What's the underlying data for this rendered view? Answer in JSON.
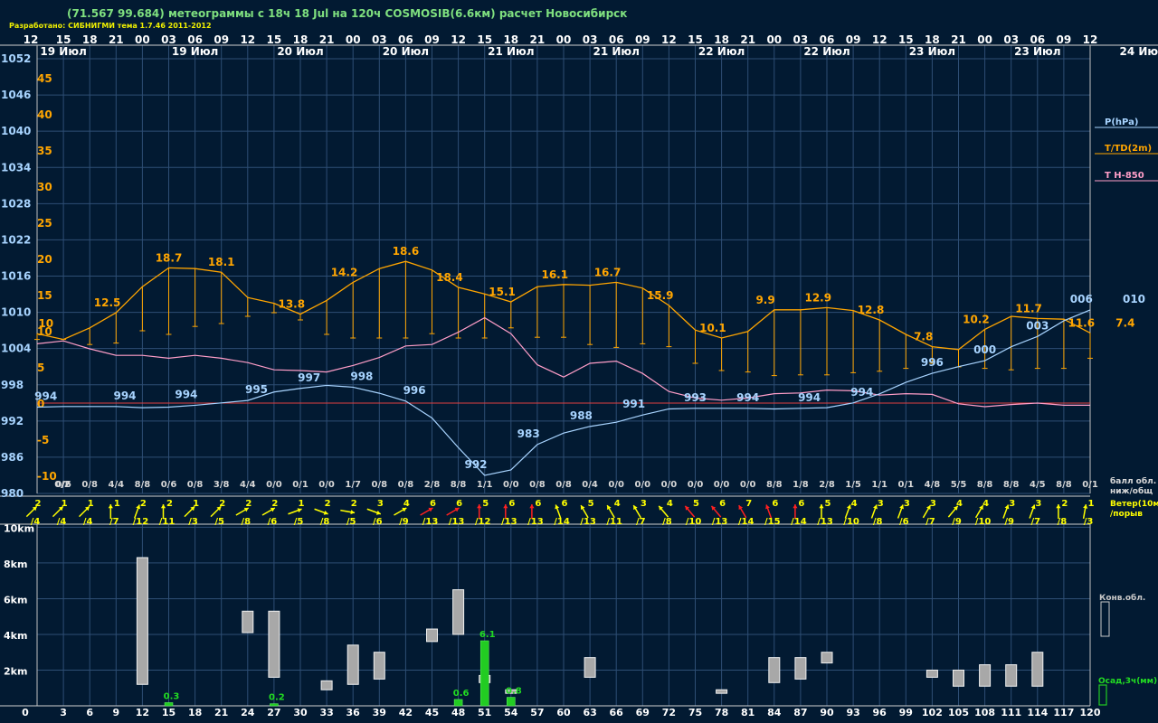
{
  "header": {
    "title": "(71.567 99.684) метеограммы с  18ч 18 Jul на 120ч COSMOSIB(6.6км) расчет Новосибирск",
    "credit": "Разработано: СИБНИГМИ тема 1.7.46 2011-2012"
  },
  "colors": {
    "background": "#021a32",
    "grid": "#2e4e74",
    "pressure": "#a8d4ff",
    "temperature": "#ffa500",
    "t850": "#ff9ec8",
    "zero_line": "#e04040",
    "cloud_bar": "#a8a8a8",
    "precip_bar": "#22cc22",
    "wind_yellow": "#ffff00",
    "wind_red": "#ff2020"
  },
  "chart_data": {
    "type": "meteogram",
    "x_hours": [
      0,
      3,
      6,
      9,
      12,
      15,
      18,
      21,
      24,
      27,
      30,
      33,
      36,
      39,
      42,
      45,
      48,
      51,
      54,
      57,
      60,
      63,
      66,
      69,
      72,
      75,
      78,
      81,
      84,
      87,
      90,
      93,
      96,
      99,
      102,
      105,
      108,
      111,
      114,
      117,
      120
    ],
    "time_labels": [
      "12",
      "15",
      "18",
      "21",
      "00",
      "03",
      "06",
      "09",
      "12",
      "15",
      "18",
      "21",
      "00",
      "03",
      "06",
      "09",
      "12",
      "15",
      "18",
      "21",
      "00",
      "03",
      "06",
      "09",
      "12",
      "15",
      "18",
      "21",
      "00",
      "03",
      "06",
      "09",
      "12",
      "15",
      "18",
      "21",
      "00",
      "03",
      "06",
      "09",
      "12"
    ],
    "date_labels": [
      {
        "hour": 3,
        "text": "19 Июл"
      },
      {
        "hour": 18,
        "text": "19 Июл"
      },
      {
        "hour": 30,
        "text": "20 Июл"
      },
      {
        "hour": 42,
        "text": "20 Июл"
      },
      {
        "hour": 54,
        "text": "21 Июл"
      },
      {
        "hour": 66,
        "text": "21 Июл"
      },
      {
        "hour": 78,
        "text": "22 Июл"
      },
      {
        "hour": 90,
        "text": "22 Июл"
      },
      {
        "hour": 102,
        "text": "23 Июл"
      },
      {
        "hour": 114,
        "text": "23 Июл"
      },
      {
        "hour": 126,
        "text": "24 Июл"
      }
    ],
    "pressure_axis": {
      "label": "P(hPa)",
      "ticks": [
        1052,
        1046,
        1040,
        1034,
        1028,
        1022,
        1016,
        1010,
        1004,
        998,
        992,
        986,
        980
      ],
      "range": [
        980,
        1052
      ]
    },
    "temperature_axis": {
      "label": "T/TD(2m)",
      "ticks": [
        "45",
        "40",
        "35",
        "30",
        "25",
        "20",
        "15",
        "10",
        "5",
        "0",
        "-5",
        "-10"
      ],
      "range": [
        -10,
        45
      ]
    },
    "t850_label": "T H-850",
    "pressure": [
      994.3,
      994.4,
      994.4,
      994.4,
      994.2,
      994.3,
      994.6,
      995,
      995.4,
      996.8,
      997.4,
      997.9,
      997.6,
      996.6,
      995.3,
      992.5,
      987.6,
      983,
      983.9,
      988.1,
      990,
      991.1,
      991.8,
      993,
      994,
      994.1,
      994.1,
      994.1,
      994,
      994.1,
      994.2,
      995,
      996.5,
      998.4,
      999.9,
      1001,
      1002,
      1004.3,
      1006,
      1008.6,
      1010.4
    ],
    "temperature": [
      9.6,
      8.8,
      10.4,
      12.5,
      16.1,
      18.7,
      18.6,
      18.1,
      14.6,
      13.8,
      12.3,
      14.2,
      16.7,
      18.6,
      19.6,
      18.4,
      16.0,
      15.1,
      14.0,
      16.1,
      16.4,
      16.3,
      16.7,
      15.9,
      13.5,
      10.1,
      9.0,
      9.9,
      12.9,
      12.9,
      13.2,
      12.8,
      11.5,
      9.5,
      7.8,
      7.4,
      10.2,
      12.0,
      11.7,
      11.6,
      9.7
    ],
    "dewpoint": [
      8.8,
      8.8,
      8.1,
      8.3,
      10,
      9.5,
      10.6,
      11,
      12,
      12.5,
      11.5,
      9.5,
      9,
      9,
      9,
      9.6,
      9,
      9,
      10.4,
      9.1,
      9.1,
      8.1,
      7.7,
      8.2,
      7.8,
      5.5,
      4.5,
      4.3,
      3.8,
      3.9,
      3.9,
      4.2,
      4.4,
      4.8,
      5.5,
      5,
      4.8,
      4.6,
      4.8,
      4.8,
      6.2
    ],
    "t850": [
      8.2,
      8.6,
      7.5,
      6.6,
      6.6,
      6.2,
      6.6,
      6.2,
      5.6,
      4.6,
      4.5,
      4.3,
      5.2,
      6.3,
      7.9,
      8.1,
      9.8,
      11.8,
      9.6,
      5.3,
      3.6,
      5.5,
      5.8,
      4.1,
      1.6,
      0.7,
      0.4,
      0.7,
      1.3,
      1.4,
      1.8,
      1.7,
      1.1,
      1.3,
      1.2,
      -0.1,
      -0.5,
      -0.2,
      0,
      -0.3,
      -0.3
    ],
    "pressure_labels": [
      {
        "hour": 1,
        "text": "994"
      },
      {
        "hour": 10,
        "text": "994"
      },
      {
        "hour": 17,
        "text": "994"
      },
      {
        "hour": 25,
        "text": "995"
      },
      {
        "hour": 31,
        "text": "997"
      },
      {
        "hour": 37,
        "text": "998"
      },
      {
        "hour": 43,
        "text": "996"
      },
      {
        "hour": 50,
        "text": "992"
      },
      {
        "hour": 56,
        "text": "983"
      },
      {
        "hour": 62,
        "text": "988"
      },
      {
        "hour": 68,
        "text": "991"
      },
      {
        "hour": 75,
        "text": "993"
      },
      {
        "hour": 81,
        "text": "994"
      },
      {
        "hour": 88,
        "text": "994"
      },
      {
        "hour": 94,
        "text": "994"
      },
      {
        "hour": 102,
        "text": "996"
      },
      {
        "hour": 108,
        "text": "000"
      },
      {
        "hour": 114,
        "text": "003"
      },
      {
        "hour": 119,
        "text": "006"
      },
      {
        "hour": 125,
        "text": "010"
      }
    ],
    "temperature_labels": [
      {
        "hour": 1,
        "text": "10"
      },
      {
        "hour": 8,
        "text": "12.5"
      },
      {
        "hour": 15,
        "text": "18.7"
      },
      {
        "hour": 21,
        "text": "18.1"
      },
      {
        "hour": 29,
        "text": "13.8"
      },
      {
        "hour": 35,
        "text": "14.2"
      },
      {
        "hour": 42,
        "text": "18.6"
      },
      {
        "hour": 47,
        "text": "18.4"
      },
      {
        "hour": 53,
        "text": "15.1"
      },
      {
        "hour": 59,
        "text": "16.1"
      },
      {
        "hour": 65,
        "text": "16.7"
      },
      {
        "hour": 71,
        "text": "15.9"
      },
      {
        "hour": 77,
        "text": "10.1"
      },
      {
        "hour": 83,
        "text": "9.9"
      },
      {
        "hour": 89,
        "text": "12.9"
      },
      {
        "hour": 95,
        "text": "12.8"
      },
      {
        "hour": 101,
        "text": "7.8"
      },
      {
        "hour": 107,
        "text": "10.2"
      },
      {
        "hour": 113,
        "text": "11.7"
      },
      {
        "hour": 119,
        "text": "11.6"
      },
      {
        "hour": 124,
        "text": "7.4"
      }
    ],
    "cloud_cover_label": "балл обл. ниж/общ",
    "cloud_cover": [
      "0/2",
      "0/6",
      "0/8",
      "4/4",
      "8/8",
      "0/6",
      "0/8",
      "3/8",
      "4/4",
      "0/0",
      "0/1",
      "0/0",
      "1/7",
      "0/8",
      "0/8",
      "2/8",
      "8/8",
      "1/1",
      "0/0",
      "0/8",
      "0/8",
      "0/4",
      "0/0",
      "0/0",
      "0/0",
      "0/0",
      "0/0",
      "0/0",
      "8/8",
      "1/8",
      "2/8",
      "1/5",
      "1/1",
      "0/1",
      "4/8",
      "5/5",
      "8/8",
      "8/8",
      "4/5",
      "8/8",
      "0/1"
    ],
    "wind_label": "Ветер(10м) /порыв",
    "wind": [
      {
        "speed": "2",
        "gust": "/4",
        "dir": 225,
        "color": "yellow"
      },
      {
        "speed": "1",
        "gust": "/4",
        "dir": 225,
        "color": "yellow"
      },
      {
        "speed": "1",
        "gust": "/4",
        "dir": 225,
        "color": "yellow"
      },
      {
        "speed": "1",
        "gust": "/7",
        "dir": 180,
        "color": "yellow"
      },
      {
        "speed": "2",
        "gust": "/12",
        "dir": 200,
        "color": "yellow"
      },
      {
        "speed": "2",
        "gust": "/11",
        "dir": 180,
        "color": "yellow"
      },
      {
        "speed": "1",
        "gust": "/3",
        "dir": 225,
        "color": "yellow"
      },
      {
        "speed": "2",
        "gust": "/5",
        "dir": 225,
        "color": "yellow"
      },
      {
        "speed": "2",
        "gust": "/8",
        "dir": 240,
        "color": "yellow"
      },
      {
        "speed": "2",
        "gust": "/6",
        "dir": 240,
        "color": "yellow"
      },
      {
        "speed": "1",
        "gust": "/5",
        "dir": 250,
        "color": "yellow"
      },
      {
        "speed": "2",
        "gust": "/8",
        "dir": 290,
        "color": "yellow"
      },
      {
        "speed": "2",
        "gust": "/5",
        "dir": 280,
        "color": "yellow"
      },
      {
        "speed": "3",
        "gust": "/6",
        "dir": 290,
        "color": "yellow"
      },
      {
        "speed": "4",
        "gust": "/9",
        "dir": 240,
        "color": "yellow"
      },
      {
        "speed": "6",
        "gust": "/13",
        "dir": 240,
        "color": "red"
      },
      {
        "speed": "6",
        "gust": "/13",
        "dir": 240,
        "color": "red"
      },
      {
        "speed": "5",
        "gust": "/12",
        "dir": 180,
        "color": "red"
      },
      {
        "speed": "6",
        "gust": "/13",
        "dir": 180,
        "color": "red"
      },
      {
        "speed": "6",
        "gust": "/13",
        "dir": 180,
        "color": "red"
      },
      {
        "speed": "6",
        "gust": "/14",
        "dir": 160,
        "color": "yellow"
      },
      {
        "speed": "5",
        "gust": "/13",
        "dir": 150,
        "color": "yellow"
      },
      {
        "speed": "4",
        "gust": "/11",
        "dir": 150,
        "color": "yellow"
      },
      {
        "speed": "3",
        "gust": "/7",
        "dir": 150,
        "color": "yellow"
      },
      {
        "speed": "4",
        "gust": "/8",
        "dir": 140,
        "color": "yellow"
      },
      {
        "speed": "5",
        "gust": "/10",
        "dir": 140,
        "color": "red"
      },
      {
        "speed": "6",
        "gust": "/13",
        "dir": 140,
        "color": "red"
      },
      {
        "speed": "7",
        "gust": "/14",
        "dir": 150,
        "color": "red"
      },
      {
        "speed": "6",
        "gust": "/15",
        "dir": 160,
        "color": "red"
      },
      {
        "speed": "6",
        "gust": "/14",
        "dir": 180,
        "color": "red"
      },
      {
        "speed": "5",
        "gust": "/13",
        "dir": 180,
        "color": "yellow"
      },
      {
        "speed": "4",
        "gust": "/10",
        "dir": 200,
        "color": "yellow"
      },
      {
        "speed": "3",
        "gust": "/8",
        "dir": 200,
        "color": "yellow"
      },
      {
        "speed": "3",
        "gust": "/6",
        "dir": 200,
        "color": "yellow"
      },
      {
        "speed": "3",
        "gust": "/7",
        "dir": 210,
        "color": "yellow"
      },
      {
        "speed": "4",
        "gust": "/9",
        "dir": 220,
        "color": "yellow"
      },
      {
        "speed": "4",
        "gust": "/10",
        "dir": 210,
        "color": "yellow"
      },
      {
        "speed": "3",
        "gust": "/9",
        "dir": 200,
        "color": "yellow"
      },
      {
        "speed": "3",
        "gust": "/7",
        "dir": 200,
        "color": "yellow"
      },
      {
        "speed": "2",
        "gust": "/8",
        "dir": 180,
        "color": "yellow"
      },
      {
        "speed": "1",
        "gust": "/3",
        "dir": 190,
        "color": "yellow"
      }
    ],
    "cloud_height_axis": {
      "ticks": [
        "10km",
        "8km",
        "6km",
        "4km",
        "2km"
      ],
      "range_km": [
        0,
        10
      ]
    },
    "convective_cloud_label": "Конв.обл.",
    "convective_clouds_km": [
      {
        "hour": 12,
        "base": 1.2,
        "top": 8.3
      },
      {
        "hour": 24,
        "base": 4.1,
        "top": 5.3
      },
      {
        "hour": 27,
        "base": 1.6,
        "top": 5.3
      },
      {
        "hour": 33,
        "base": 0.9,
        "top": 1.4
      },
      {
        "hour": 36,
        "base": 1.2,
        "top": 3.4
      },
      {
        "hour": 39,
        "base": 1.5,
        "top": 3.0
      },
      {
        "hour": 45,
        "base": 3.6,
        "top": 4.3
      },
      {
        "hour": 48,
        "base": 4.0,
        "top": 6.5
      },
      {
        "hour": 51,
        "base": 1.3,
        "top": 1.7
      },
      {
        "hour": 54,
        "base": 0.7,
        "top": 0.9
      },
      {
        "hour": 63,
        "base": 1.6,
        "top": 2.7
      },
      {
        "hour": 78,
        "base": 0.7,
        "top": 0.9
      },
      {
        "hour": 84,
        "base": 1.3,
        "top": 2.7
      },
      {
        "hour": 87,
        "base": 1.5,
        "top": 2.7
      },
      {
        "hour": 90,
        "base": 2.4,
        "top": 3.0
      },
      {
        "hour": 102,
        "base": 1.6,
        "top": 2.0
      },
      {
        "hour": 105,
        "base": 1.1,
        "top": 2.0
      },
      {
        "hour": 108,
        "base": 1.1,
        "top": 2.3
      },
      {
        "hour": 111,
        "base": 1.1,
        "top": 2.3
      },
      {
        "hour": 114,
        "base": 1.1,
        "top": 3.0
      }
    ],
    "precip_label": "Осад,3ч(мм)",
    "precipitation_mm": [
      {
        "hour": 15,
        "value": 0.3,
        "text": "0.3"
      },
      {
        "hour": 27,
        "value": 0.2,
        "text": "0.2"
      },
      {
        "hour": 48,
        "value": 0.6,
        "text": "0.6"
      },
      {
        "hour": 51,
        "value": 6.1,
        "text": "6.1"
      },
      {
        "hour": 54,
        "value": 0.8,
        "text": "0.8"
      }
    ]
  }
}
